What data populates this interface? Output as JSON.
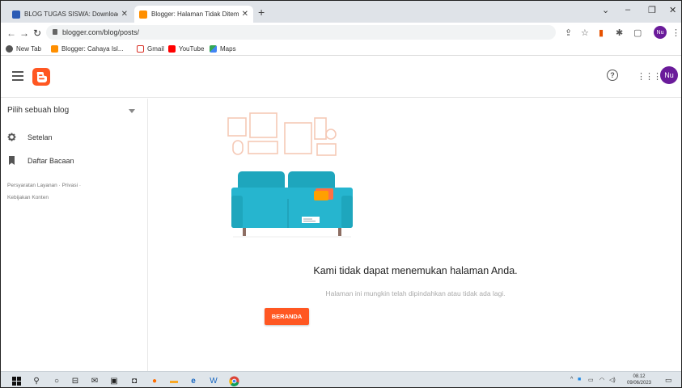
{
  "browser": {
    "tabs": [
      {
        "title": "BLOG TUGAS SISWA: Download ...",
        "active": false
      },
      {
        "title": "Blogger: Halaman Tidak Ditemu",
        "active": true
      }
    ],
    "url": "blogger.com/blog/posts/",
    "bookmarks": [
      {
        "label": "New Tab"
      },
      {
        "label": "Blogger: Cahaya Isl..."
      },
      {
        "label": "Gmail"
      },
      {
        "label": "YouTube"
      },
      {
        "label": "Maps"
      }
    ],
    "profile_initials": "Nu"
  },
  "header": {
    "profile_initials": "Nu"
  },
  "sidebar": {
    "blog_selector": "Pilih sebuah blog",
    "items": [
      {
        "label": "Setelan",
        "icon": "gear-icon"
      },
      {
        "label": "Daftar Bacaan",
        "icon": "bookmark-icon"
      }
    ],
    "footer_links": [
      "Persyaratan Layanan",
      "Privasi",
      "Kebijakan Konten"
    ]
  },
  "main": {
    "error_title": "Kami tidak dapat menemukan halaman Anda.",
    "error_subtitle": "Halaman ini mungkin telah dipindahkan atau tidak ada lagi.",
    "home_button": "BERANDA"
  },
  "taskbar": {
    "time": "08.12",
    "date": "09/06/2023"
  },
  "colors": {
    "accent": "#ff5722",
    "avatar": "#6a1b9a",
    "sofa": "#26b5cf"
  }
}
